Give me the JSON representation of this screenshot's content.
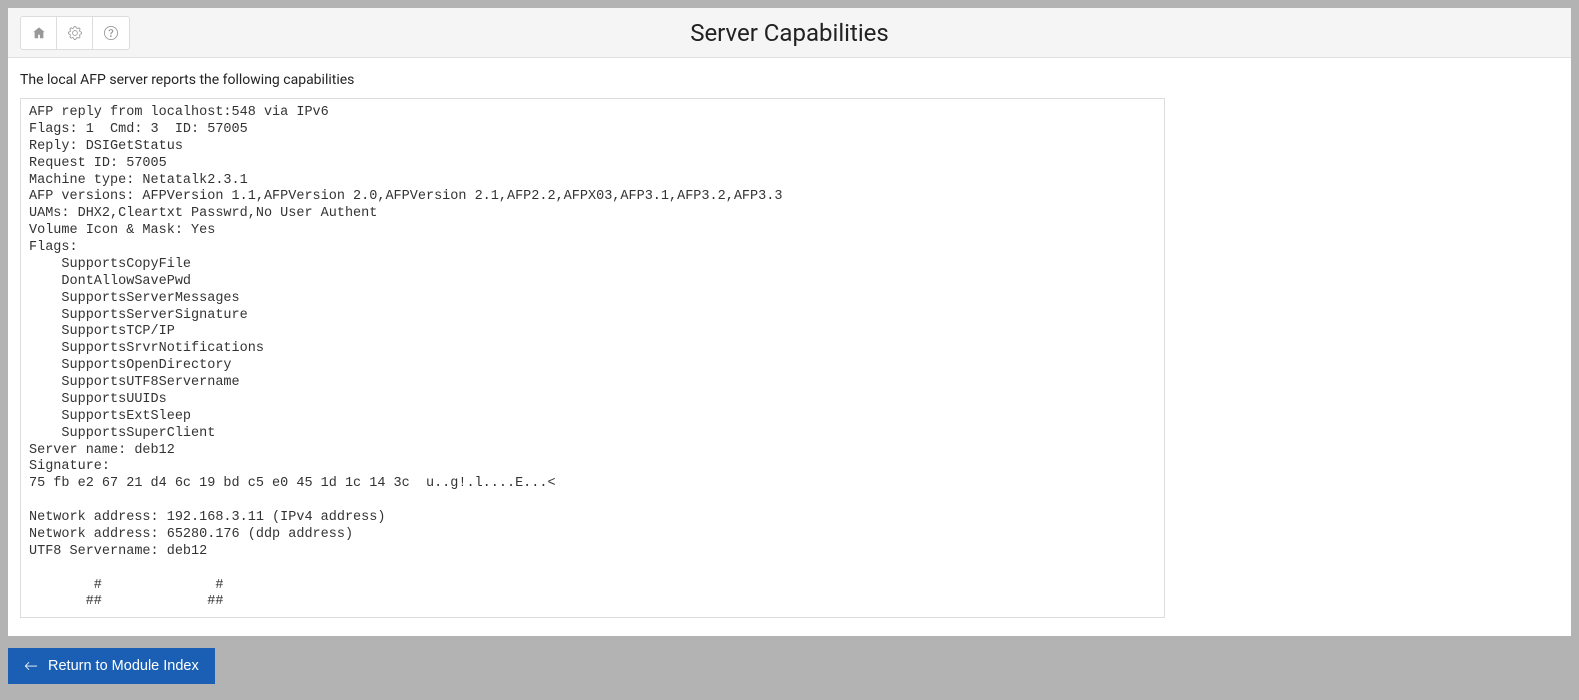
{
  "header": {
    "title": "Server Capabilities"
  },
  "content": {
    "intro": "The local AFP server reports the following capabilities",
    "capabilities_text": "AFP reply from localhost:548 via IPv6\nFlags: 1  Cmd: 3  ID: 57005\nReply: DSIGetStatus\nRequest ID: 57005\nMachine type: Netatalk2.3.1\nAFP versions: AFPVersion 1.1,AFPVersion 2.0,AFPVersion 2.1,AFP2.2,AFPX03,AFP3.1,AFP3.2,AFP3.3\nUAMs: DHX2,Cleartxt Passwrd,No User Authent\nVolume Icon & Mask: Yes\nFlags: \n    SupportsCopyFile\n    DontAllowSavePwd\n    SupportsServerMessages\n    SupportsServerSignature\n    SupportsTCP/IP\n    SupportsSrvrNotifications\n    SupportsOpenDirectory\n    SupportsUTF8Servername\n    SupportsUUIDs\n    SupportsExtSleep\n    SupportsSuperClient\nServer name: deb12\nSignature:\n75 fb e2 67 21 d4 6c 19 bd c5 e0 45 1d 1c 14 3c  u..g!.l....E...<\n\nNetwork address: 192.168.3.11 (IPv4 address)\nNetwork address: 65280.176 (ddp address)\nUTF8 Servername: deb12\n\n        #              #\n       ##             ##"
  },
  "footer": {
    "return_label": "Return to Module Index"
  }
}
